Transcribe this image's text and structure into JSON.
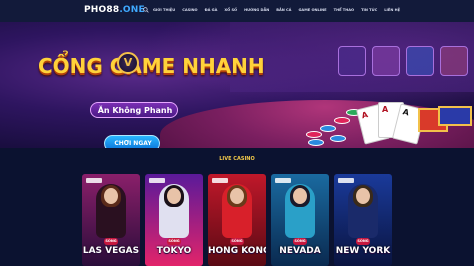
{
  "header": {
    "logo_main": "PHO88",
    "logo_dot": ".ONE",
    "menu": [
      "GIỚI THIỆU",
      "CASINO",
      "ĐÁ GÀ",
      "XỔ SỐ",
      "HƯỚNG DẪN",
      "BẮN CÁ",
      "GAME ONLINE",
      "THỂ THAO",
      "TIN TỨC",
      "LIÊN HỆ"
    ]
  },
  "banner": {
    "title": "CỔNG GAME NHANH",
    "badge_letter": "V",
    "subtitle": "Ăn Không Phanh",
    "cta": "CHƠI NGAY",
    "carousel_dots": 3,
    "active_dot": 1
  },
  "live_casino": {
    "title": "LIVE CASINO",
    "tiles": [
      {
        "badge": "SÒNG",
        "city": "LAS VEGAS",
        "bg": "#8a1f6a",
        "bg2": "#2a0d3a"
      },
      {
        "badge": "SÒNG",
        "city": "TOKYO",
        "bg": "#5a1a9a",
        "bg2": "#e2246a"
      },
      {
        "badge": "SÒNG",
        "city": "HONG KONG",
        "bg": "#c0182a",
        "bg2": "#5a0a14"
      },
      {
        "badge": "SÒNG",
        "city": "NEVADA",
        "bg": "#1a6aa0",
        "bg2": "#0a2a50"
      },
      {
        "badge": "SÒNG",
        "city": "NEW YORK",
        "bg": "#1a3a9a",
        "bg2": "#0a1440"
      }
    ]
  },
  "colors": {
    "nav_bg": "#121a3a",
    "page_bg": "#0b1230",
    "title_gold": "#ffd23a",
    "cta_blue": "#0a6fd6",
    "section_title": "#f2c94a"
  },
  "icons": [
    "search-icon"
  ]
}
